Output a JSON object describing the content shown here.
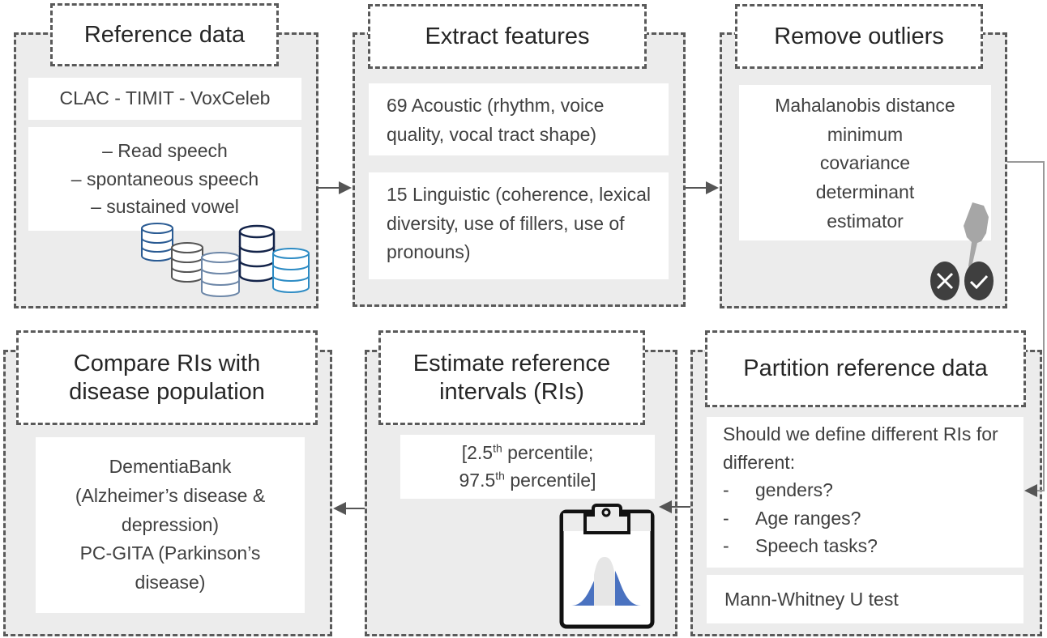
{
  "steps": {
    "reference": {
      "title": "Reference data",
      "datasets": "CLAC - TIMIT - VoxCeleb",
      "items": [
        "– Read speech",
        "– spontaneous speech",
        "– sustained vowel"
      ]
    },
    "extract": {
      "title": "Extract features",
      "acoustic": "69 Acoustic (rhythm, voice quality, vocal tract shape)",
      "linguistic": "15 Linguistic (coherence, lexical diversity, use of fillers, use of pronouns)"
    },
    "outliers": {
      "title": "Remove outliers",
      "method": [
        "Mahalanobis distance",
        "minimum",
        "covariance",
        "determinant",
        "estimator"
      ]
    },
    "partition": {
      "title": "Partition reference data",
      "question": "Should we define different RIs for different:",
      "items": [
        "genders?",
        "Age ranges?",
        "Speech tasks?"
      ],
      "bullet": "-",
      "test": "Mann-Whitney U test"
    },
    "estimate": {
      "title": "Estimate reference intervals (RIs)",
      "line1_pre": "[2.5",
      "line1_sup": "th",
      "line1_post": " percentile;",
      "line2_pre": "97.5",
      "line2_sup": "th",
      "line2_post": " percentile]"
    },
    "compare": {
      "title": "Compare RIs with disease population",
      "lines": [
        "DementiaBank",
        "(Alzheimer’s disease &",
        "depression)",
        "PC-GITA (Parkinson’s",
        "disease)"
      ]
    }
  },
  "colors": {
    "panel": "#ececec",
    "border": "#5a5a5a",
    "distribution_tail": "#4a72c0"
  }
}
